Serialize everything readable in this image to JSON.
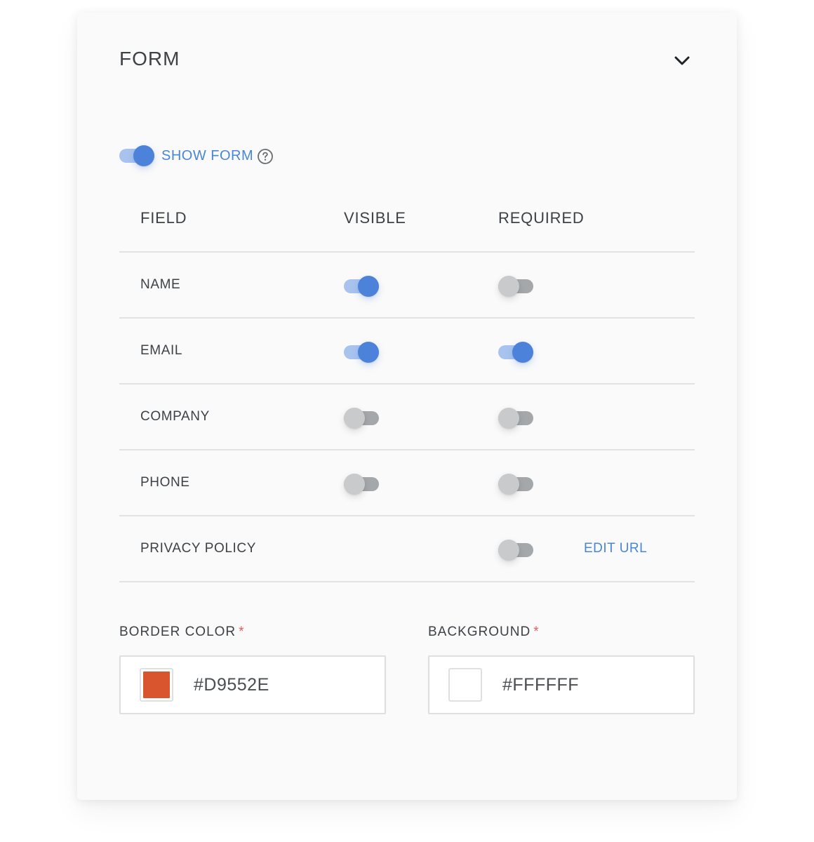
{
  "panel": {
    "title": "FORM"
  },
  "show_form": {
    "label": "SHOW FORM",
    "on": true
  },
  "table": {
    "headers": [
      "FIELD",
      "VISIBLE",
      "REQUIRED"
    ],
    "rows": [
      {
        "field": "NAME",
        "visible": true,
        "required": false
      },
      {
        "field": "EMAIL",
        "visible": true,
        "required": true
      },
      {
        "field": "COMPANY",
        "visible": false,
        "required": false
      },
      {
        "field": "PHONE",
        "visible": false,
        "required": false
      },
      {
        "field": "PRIVACY POLICY",
        "visible": null,
        "required": false,
        "action": "EDIT URL"
      }
    ]
  },
  "colors": {
    "border": {
      "label": "BORDER COLOR",
      "required_mark": "*",
      "value": "#D9552E",
      "swatch": "#D9552E"
    },
    "background": {
      "label": "BACKGROUND",
      "required_mark": "*",
      "value": "#FFFFFF",
      "swatch": "#FFFFFF"
    }
  },
  "theme": {
    "accent": "#4D82DB",
    "link": "#4A86D8",
    "required": "#E35D5D"
  },
  "icons": {
    "collapse": "chevron-down-icon",
    "help": "help-circle-icon"
  }
}
